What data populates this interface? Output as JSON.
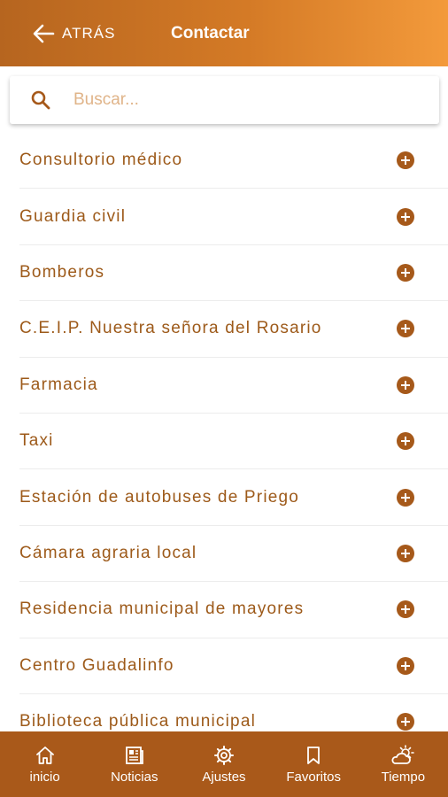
{
  "header": {
    "back_label": "ATRÁS",
    "title": "Contactar"
  },
  "search": {
    "placeholder": "Buscar...",
    "value": ""
  },
  "contacts": [
    {
      "label": "Consultorio médico"
    },
    {
      "label": "Guardia civil"
    },
    {
      "label": "Bomberos"
    },
    {
      "label": "C.E.I.P. Nuestra señora del Rosario"
    },
    {
      "label": "Farmacia"
    },
    {
      "label": "Taxi"
    },
    {
      "label": "Estación de autobuses de Priego"
    },
    {
      "label": "Cámara agraria local"
    },
    {
      "label": "Residencia municipal de mayores"
    },
    {
      "label": "Centro Guadalinfo"
    },
    {
      "label": "Biblioteca pública municipal"
    }
  ],
  "tabbar": {
    "items": [
      {
        "label": "inicio",
        "icon": "home-icon"
      },
      {
        "label": "Noticias",
        "icon": "newspaper-icon"
      },
      {
        "label": "Ajustes",
        "icon": "gear-icon"
      },
      {
        "label": "Favoritos",
        "icon": "bookmark-icon"
      },
      {
        "label": "Tiempo",
        "icon": "weather-icon"
      }
    ]
  },
  "colors": {
    "header_gradient_start": "#b6651f",
    "header_gradient_end": "#f39a3b",
    "accent": "#9d5a1a",
    "tabbar_bg": "#a9591a"
  }
}
